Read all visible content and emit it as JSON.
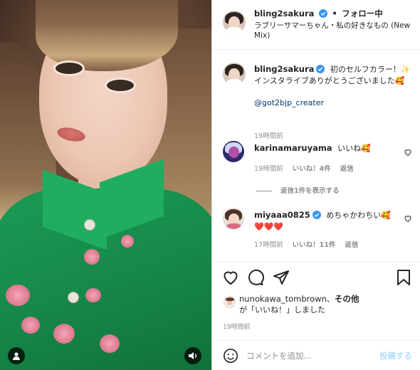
{
  "header": {
    "username": "bling2sakura",
    "separator": "•",
    "follow_status": "フォロー中",
    "audio": "ラブリーサマーちゃん・私の好きなもの (New Mix)"
  },
  "caption": {
    "username": "bling2sakura",
    "text": "初のセルフカラー！✨インスタライブありがとうございました🥰",
    "mention": "@got2bjp_creater",
    "time": "19時間前"
  },
  "comments": [
    {
      "username": "karinamaruyama",
      "text": "いいね🥰",
      "time": "19時間前",
      "likes": "いいね！4件",
      "reply": "返信",
      "view_replies": "返信1件を表示する"
    },
    {
      "username": "miyaaa0825",
      "text": "めちゃかわちい🥰",
      "text2": "❤️❤️❤️",
      "time": "17時間前",
      "likes": "いいね！11件",
      "reply": "返信"
    }
  ],
  "liked_by": {
    "username": "nunokawa_tombrown",
    "connector": "、",
    "others": "その他",
    "suffix": "が「いいね！」しました"
  },
  "post_time": "19時間前",
  "add_comment": {
    "placeholder": "コメントを追加...",
    "post_label": "投稿する"
  },
  "colors": {
    "verified": "#3897f0",
    "link": "#00376b",
    "post_disabled": "#b2dffc",
    "meta_gray": "#8e8e8e"
  },
  "icons": [
    "user-icon",
    "sound-icon",
    "heart-icon",
    "comment-icon",
    "share-icon",
    "bookmark-icon",
    "emoji-icon",
    "verified-icon"
  ]
}
